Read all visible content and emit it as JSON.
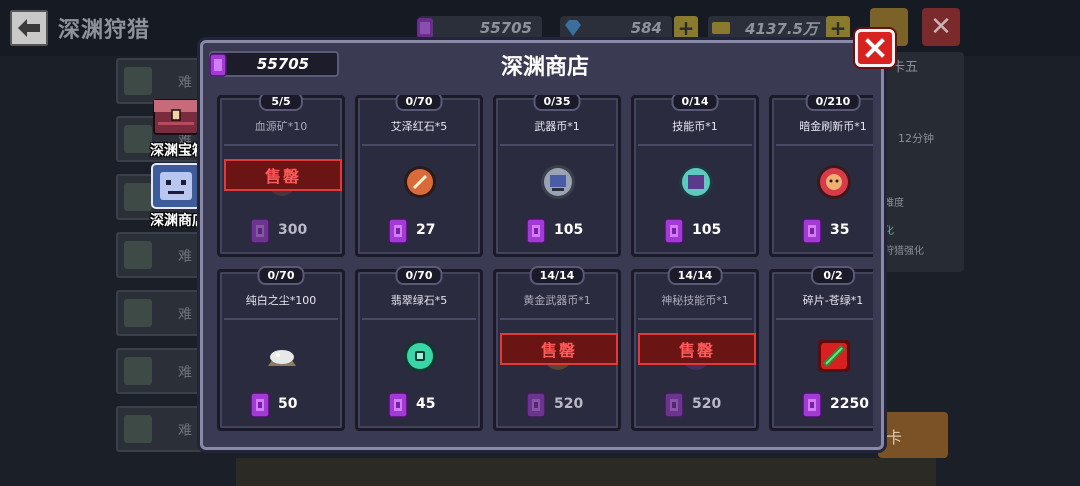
{
  "header": {
    "back_icon": "arrow-left-icon",
    "title": "深渊狩猎",
    "gems": "55705",
    "diamonds": "584",
    "coins": "4137.5万"
  },
  "left_list": {
    "rows": [
      "难",
      "难",
      "难",
      "难",
      "难",
      "难",
      "难"
    ]
  },
  "right_panel": {
    "tag": "卡五",
    "time": "12分钟",
    "line1": "难度",
    "line2": "化",
    "line3": "狩猎强化",
    "button_partial": "卡"
  },
  "side_tabs": [
    {
      "label": "深渊宝箱",
      "icon": "treasure-chest-icon"
    },
    {
      "label": "深渊商店",
      "icon": "shop-merchant-icon"
    }
  ],
  "dialog": {
    "title": "深渊商店",
    "gem_balance": "55705",
    "close_icon": "close-x-icon",
    "sold_label": "售罄",
    "items": [
      {
        "count": "5/5",
        "name": "血源矿*10",
        "price": "300",
        "sold": true,
        "icon": "blood-ore-icon"
      },
      {
        "count": "0/70",
        "name": "艾泽红石*5",
        "price": "27",
        "sold": false,
        "icon": "red-stone-icon"
      },
      {
        "count": "0/35",
        "name": "武器币*1",
        "price": "105",
        "sold": false,
        "icon": "weapon-coin-icon"
      },
      {
        "count": "0/14",
        "name": "技能币*1",
        "price": "105",
        "sold": false,
        "icon": "skill-coin-icon"
      },
      {
        "count": "0/210",
        "name": "暗金刷新币*1",
        "price": "35",
        "sold": false,
        "icon": "refresh-coin-icon"
      },
      {
        "count": "0/70",
        "name": "纯白之尘*100",
        "price": "50",
        "sold": false,
        "icon": "white-dust-icon"
      },
      {
        "count": "0/70",
        "name": "翡翠绿石*5",
        "price": "45",
        "sold": false,
        "icon": "green-stone-icon"
      },
      {
        "count": "14/14",
        "name": "黄金武器币*1",
        "price": "520",
        "sold": true,
        "icon": "gold-weapon-coin-icon"
      },
      {
        "count": "14/14",
        "name": "神秘技能币*1",
        "price": "520",
        "sold": true,
        "icon": "mystic-skill-coin-icon"
      },
      {
        "count": "0/2",
        "name": "碎片-苍绿*1",
        "price": "2250",
        "sold": false,
        "icon": "shard-green-icon"
      }
    ]
  },
  "colors": {
    "gem_purple": "#a23bd6",
    "sold_red": "#e03a3a",
    "dialog_bg": "#3a3a52",
    "close_red": "#d8221f"
  }
}
